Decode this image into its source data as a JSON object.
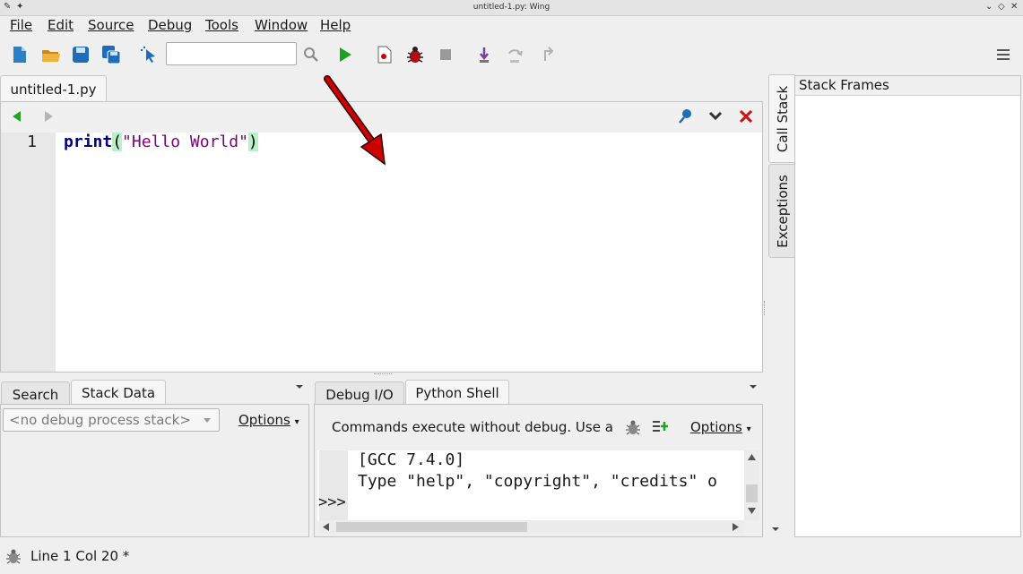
{
  "window": {
    "title": "untitled-1.py: Wing"
  },
  "menu": [
    "File",
    "Edit",
    "Source",
    "Debug",
    "Tools",
    "Window",
    "Help"
  ],
  "toolbar": {
    "search_value": ""
  },
  "editor": {
    "tab_label": "untitled-1.py",
    "line_number": "1",
    "code": {
      "keyword": "print",
      "open_paren": "(",
      "string": "\"Hello World\"",
      "close_paren": ")"
    }
  },
  "left_panel": {
    "tabs": [
      "Search",
      "Stack Data"
    ],
    "active_tab": "Stack Data",
    "stack_combo": "<no debug process stack>",
    "options_label": "Options"
  },
  "right_panel": {
    "tabs": [
      "Debug I/O",
      "Python Shell"
    ],
    "active_tab": "Python Shell",
    "info": "Commands execute without debug.  Use arı",
    "options_label": "Options",
    "shell_lines": [
      "[GCC 7.4.0]",
      "Type \"help\", \"copyright\", \"credits\" o"
    ],
    "prompt": ">>>"
  },
  "dock": {
    "tabs": [
      "Call Stack",
      "Exceptions"
    ],
    "active_tab": "Call Stack",
    "header": "Stack Frames"
  },
  "status": {
    "text": "Line 1 Col 20 *"
  },
  "colors": {
    "keyword": "#000080",
    "string": "#7f007f",
    "paren_highlight": "#b9f0c8",
    "arrow": "#cc0000"
  }
}
